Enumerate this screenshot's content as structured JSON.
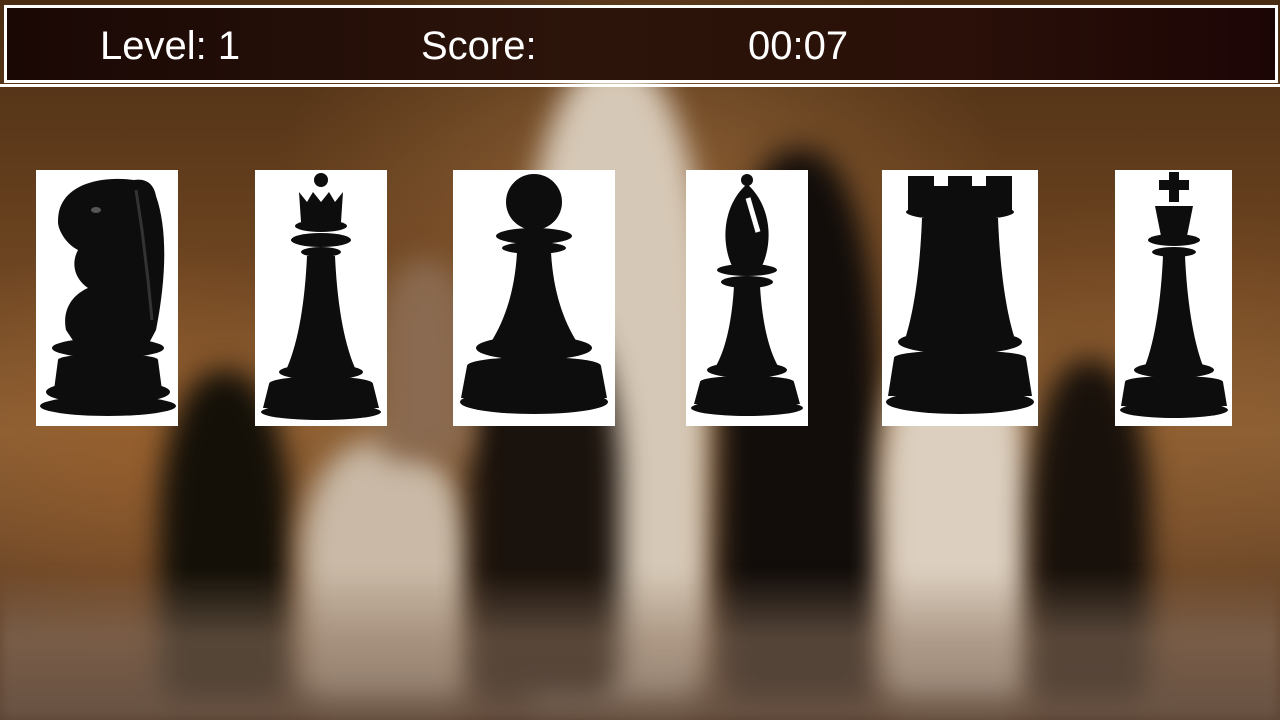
{
  "hud": {
    "level_label": "Level:",
    "level_value": "1",
    "score_label": "Score:",
    "score_value": "",
    "timer": "00:07"
  },
  "cards": [
    {
      "piece": "knight-icon"
    },
    {
      "piece": "queen-icon"
    },
    {
      "piece": "pawn-icon"
    },
    {
      "piece": "bishop-icon"
    },
    {
      "piece": "rook-icon"
    },
    {
      "piece": "king-icon"
    }
  ],
  "colors": {
    "piece": "#0d0d0d",
    "card_background": "#ffffff",
    "hud_text": "#ffffff",
    "hud_background": "#24100a"
  }
}
